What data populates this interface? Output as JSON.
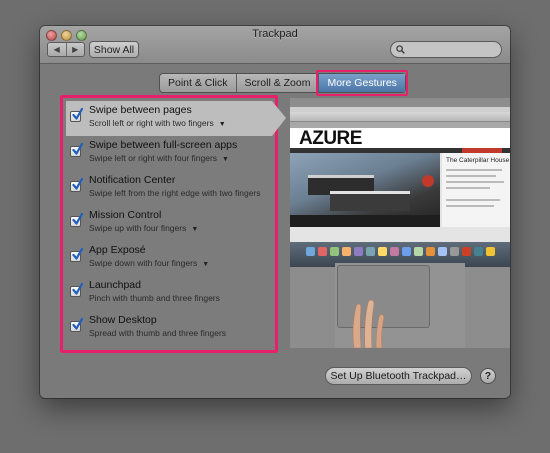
{
  "window": {
    "title": "Trackpad"
  },
  "toolbar": {
    "back_label": "◀",
    "forward_label": "▶",
    "show_all_label": "Show All",
    "search_placeholder": ""
  },
  "tabs": [
    {
      "label": "Point & Click",
      "active": false
    },
    {
      "label": "Scroll & Zoom",
      "active": false
    },
    {
      "label": "More Gestures",
      "active": true
    }
  ],
  "gestures": [
    {
      "title": "Swipe between pages",
      "subtitle": "Scroll left or right with two fingers",
      "has_menu": true,
      "checked": true,
      "selected": true
    },
    {
      "title": "Swipe between full-screen apps",
      "subtitle": "Swipe left or right with four fingers",
      "has_menu": true,
      "checked": true,
      "selected": false
    },
    {
      "title": "Notification Center",
      "subtitle": "Swipe left from the right edge with two fingers",
      "has_menu": false,
      "checked": true,
      "selected": false
    },
    {
      "title": "Mission Control",
      "subtitle": "Swipe up with four fingers",
      "has_menu": true,
      "checked": true,
      "selected": false
    },
    {
      "title": "App Exposé",
      "subtitle": "Swipe down with four fingers",
      "has_menu": true,
      "checked": true,
      "selected": false
    },
    {
      "title": "Launchpad",
      "subtitle": "Pinch with thumb and three fingers",
      "has_menu": false,
      "checked": true,
      "selected": false
    },
    {
      "title": "Show Desktop",
      "subtitle": "Spread with thumb and three fingers",
      "has_menu": false,
      "checked": true,
      "selected": false
    }
  ],
  "preview": {
    "site_logo": "AZURE",
    "sidebar_caption": "The Caterpillar House",
    "dock_icon_colors": [
      "#6fa8dc",
      "#e06666",
      "#93c47d",
      "#f6b26b",
      "#8e7cc3",
      "#76a5af",
      "#ffd966",
      "#c27ba0",
      "#6d9eeb",
      "#b6d7a8",
      "#e69138",
      "#a4c2f4",
      "#999999",
      "#cc4125",
      "#45818e",
      "#f1c232"
    ]
  },
  "footer": {
    "bluetooth_button_label": "Set Up Bluetooth Trackpad…",
    "help_label": "?"
  },
  "colors": {
    "highlight": "#e6206a",
    "active_tab": "#4a76a8",
    "checkbox_check": "#1f5fbf"
  }
}
